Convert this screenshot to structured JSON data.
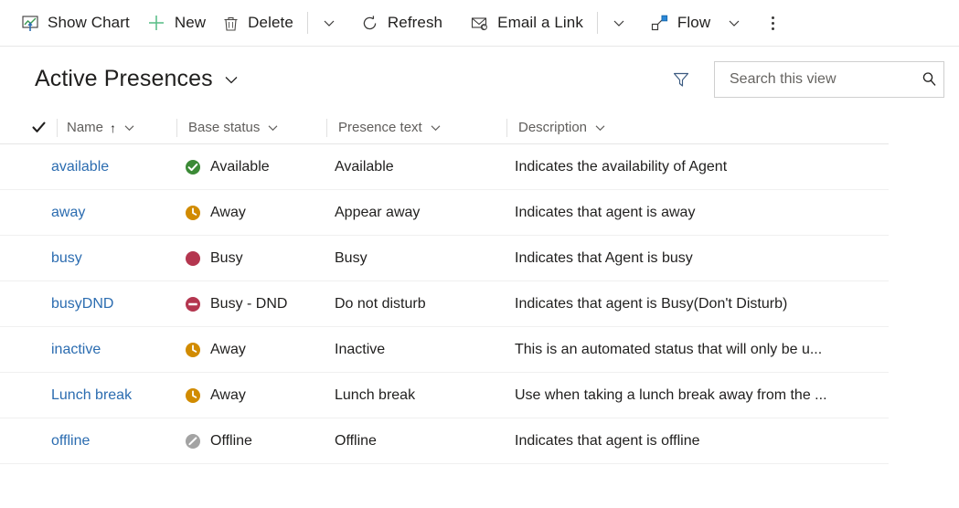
{
  "command_bar": {
    "items": [
      {
        "id": "show-chart",
        "label": "Show Chart",
        "icon": "chart-icon"
      },
      {
        "id": "new",
        "label": "New",
        "icon": "plus-icon"
      },
      {
        "id": "delete",
        "label": "Delete",
        "icon": "trash-icon"
      },
      {
        "id": "refresh",
        "label": "Refresh",
        "icon": "refresh-icon"
      },
      {
        "id": "email-link",
        "label": "Email a Link",
        "icon": "envelope-icon"
      },
      {
        "id": "flow",
        "label": "Flow",
        "icon": "flow-icon"
      }
    ],
    "overflow_label": "More commands",
    "chevron_icon": "chevron-down-icon"
  },
  "view": {
    "title": "Active Presences",
    "title_chevron_icon": "chevron-down-icon",
    "filter_icon": "filter-icon"
  },
  "search": {
    "placeholder": "Search this view",
    "value": "",
    "icon": "search-icon"
  },
  "grid": {
    "select_all_icon": "checkmark-icon",
    "columns": [
      {
        "id": "name",
        "label": "Name",
        "sorted": true,
        "sort_arrow": "↑"
      },
      {
        "id": "base-status",
        "label": "Base status",
        "sorted": false,
        "sort_arrow": ""
      },
      {
        "id": "presence-text",
        "label": "Presence text",
        "sorted": false,
        "sort_arrow": ""
      },
      {
        "id": "description",
        "label": "Description",
        "sorted": false,
        "sort_arrow": ""
      }
    ],
    "rows": [
      {
        "name": "available",
        "base_status": "Available",
        "base_status_icon": "available-icon",
        "presence_text": "Available",
        "description": "Indicates the availability of Agent"
      },
      {
        "name": "away",
        "base_status": "Away",
        "base_status_icon": "away-icon",
        "presence_text": "Appear away",
        "description": "Indicates that agent is away"
      },
      {
        "name": "busy",
        "base_status": "Busy",
        "base_status_icon": "busy-icon",
        "presence_text": "Busy",
        "description": "Indicates that Agent is busy"
      },
      {
        "name": "busyDND",
        "base_status": "Busy - DND",
        "base_status_icon": "dnd-icon",
        "presence_text": "Do not disturb",
        "description": "Indicates that agent is Busy(Don't Disturb)"
      },
      {
        "name": "inactive",
        "base_status": "Away",
        "base_status_icon": "away-icon",
        "presence_text": "Inactive",
        "description": "This is an automated status that will only be u..."
      },
      {
        "name": "Lunch break",
        "base_status": "Away",
        "base_status_icon": "away-icon",
        "presence_text": "Lunch break",
        "description": "Use when taking a lunch break away from the ..."
      },
      {
        "name": "offline",
        "base_status": "Offline",
        "base_status_icon": "offline-icon",
        "presence_text": "Offline",
        "description": "Indicates that agent is offline"
      }
    ]
  },
  "colors": {
    "available_green": "#3b8a36",
    "away_amber": "#d18b00",
    "busy_crimson": "#b4364f",
    "dnd_crimson": "#b4364f",
    "offline_gray": "#a3a3a3",
    "link_blue": "#2b6cb0",
    "flow_blue": "#2b88d8",
    "new_green": "#5ec08a"
  }
}
